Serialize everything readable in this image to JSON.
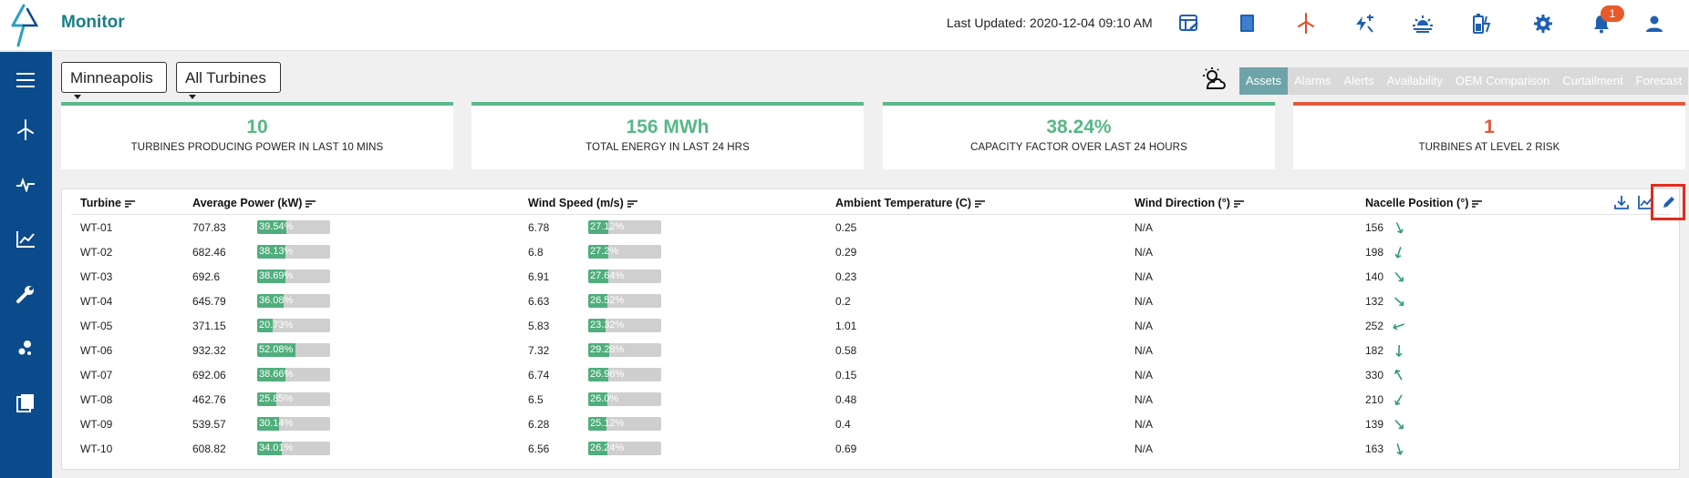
{
  "header": {
    "app_title": "Monitor",
    "last_updated": "Last Updated: 2020-12-04 09:10 AM",
    "notification_count": "1",
    "icons": [
      "dashboard-icon",
      "book-icon",
      "turbine-icon",
      "power-alert-icon",
      "sunset-icon",
      "battery-icon",
      "gear-icon",
      "bell-icon",
      "user-icon"
    ],
    "accent_color": "#1a7e87"
  },
  "sidebar": {
    "items": [
      "menu-icon",
      "turbine-icon",
      "pulse-icon",
      "line-chart-icon",
      "wrench-icon",
      "scatter-icon",
      "library-icon"
    ],
    "color": "#0b4a8b"
  },
  "filters": {
    "site": "Minneapolis",
    "turbines": "All Turbines"
  },
  "tabs": [
    {
      "label": "Assets",
      "active": true
    },
    {
      "label": "Alarms",
      "active": false
    },
    {
      "label": "Alerts",
      "active": false
    },
    {
      "label": "Availability",
      "active": false
    },
    {
      "label": "OEM Comparison",
      "active": false
    },
    {
      "label": "Curtailment",
      "active": false
    },
    {
      "label": "Forecast",
      "active": false
    }
  ],
  "kpis": [
    {
      "value": "10",
      "label": "TURBINES PRODUCING POWER IN LAST 10 MINS",
      "status": "green"
    },
    {
      "value": "156 MWh",
      "label": "TOTAL ENERGY IN LAST 24 HRS",
      "status": "green"
    },
    {
      "value": "38.24%",
      "label": "CAPACITY FACTOR OVER LAST 24 HOURS",
      "status": "green"
    },
    {
      "value": "1",
      "label": "TURBINES AT LEVEL 2 RISK",
      "status": "red"
    }
  ],
  "table": {
    "columns": [
      "Turbine",
      "Average Power (kW)",
      "Wind Speed (m/s)",
      "Ambient Temperature (C)",
      "Wind Direction (°)",
      "Nacelle Position (°)"
    ],
    "toolbar_icons": [
      "download-icon",
      "chart-icon",
      "edit-icon"
    ],
    "rows": [
      {
        "turbine": "WT-01",
        "power": "707.83",
        "power_pct": "39.54%",
        "power_frac": 0.3954,
        "wind": "6.78",
        "wind_pct": "27.12%",
        "wind_frac": 0.2712,
        "temp": "0.25",
        "direction": "N/A",
        "nacelle": "156",
        "nacelle_deg": 156
      },
      {
        "turbine": "WT-02",
        "power": "682.46",
        "power_pct": "38.13%",
        "power_frac": 0.3813,
        "wind": "6.8",
        "wind_pct": "27.2%",
        "wind_frac": 0.272,
        "temp": "0.29",
        "direction": "N/A",
        "nacelle": "198",
        "nacelle_deg": 198
      },
      {
        "turbine": "WT-03",
        "power": "692.6",
        "power_pct": "38.69%",
        "power_frac": 0.3869,
        "wind": "6.91",
        "wind_pct": "27.64%",
        "wind_frac": 0.2764,
        "temp": "0.23",
        "direction": "N/A",
        "nacelle": "140",
        "nacelle_deg": 140
      },
      {
        "turbine": "WT-04",
        "power": "645.79",
        "power_pct": "36.08%",
        "power_frac": 0.3608,
        "wind": "6.63",
        "wind_pct": "26.52%",
        "wind_frac": 0.2652,
        "temp": "0.2",
        "direction": "N/A",
        "nacelle": "132",
        "nacelle_deg": 132
      },
      {
        "turbine": "WT-05",
        "power": "371.15",
        "power_pct": "20.73%",
        "power_frac": 0.2073,
        "wind": "5.83",
        "wind_pct": "23.32%",
        "wind_frac": 0.2332,
        "temp": "1.01",
        "direction": "N/A",
        "nacelle": "252",
        "nacelle_deg": 252
      },
      {
        "turbine": "WT-06",
        "power": "932.32",
        "power_pct": "52.08%",
        "power_frac": 0.5208,
        "wind": "7.32",
        "wind_pct": "29.28%",
        "wind_frac": 0.2928,
        "temp": "0.58",
        "direction": "N/A",
        "nacelle": "182",
        "nacelle_deg": 182
      },
      {
        "turbine": "WT-07",
        "power": "692.06",
        "power_pct": "38.66%",
        "power_frac": 0.3866,
        "wind": "6.74",
        "wind_pct": "26.96%",
        "wind_frac": 0.2696,
        "temp": "0.15",
        "direction": "N/A",
        "nacelle": "330",
        "nacelle_deg": 330
      },
      {
        "turbine": "WT-08",
        "power": "462.76",
        "power_pct": "25.85%",
        "power_frac": 0.2585,
        "wind": "6.5",
        "wind_pct": "26.0%",
        "wind_frac": 0.26,
        "temp": "0.48",
        "direction": "N/A",
        "nacelle": "210",
        "nacelle_deg": 210
      },
      {
        "turbine": "WT-09",
        "power": "539.57",
        "power_pct": "30.14%",
        "power_frac": 0.3014,
        "wind": "6.28",
        "wind_pct": "25.12%",
        "wind_frac": 0.2512,
        "temp": "0.4",
        "direction": "N/A",
        "nacelle": "139",
        "nacelle_deg": 139
      },
      {
        "turbine": "WT-10",
        "power": "608.82",
        "power_pct": "34.01%",
        "power_frac": 0.3401,
        "wind": "6.56",
        "wind_pct": "26.24%",
        "wind_frac": 0.2624,
        "temp": "0.69",
        "direction": "N/A",
        "nacelle": "163",
        "nacelle_deg": 163
      }
    ]
  },
  "colors": {
    "bar_fill": "#4fae7c",
    "bar_track": "#cfcfcf",
    "kpi_green": "#56b885",
    "kpi_red": "#e25a3c",
    "tab_active": "#6ea4a9",
    "highlight": "#e32b1f"
  }
}
